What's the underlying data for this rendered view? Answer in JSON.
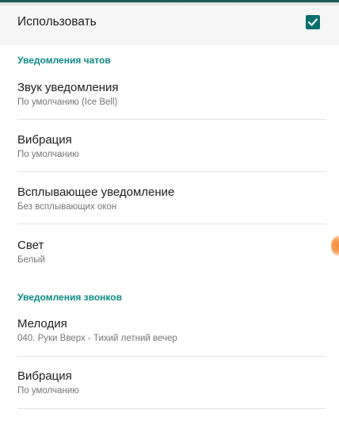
{
  "master": {
    "label": "Использовать",
    "checked": true
  },
  "sections": {
    "chats": {
      "header": "Уведомления чатов",
      "sound": {
        "title": "Звук уведомления",
        "summary": "По умолчанию (Ice Bell)"
      },
      "vibration": {
        "title": "Вибрация",
        "summary": "По умолчанию"
      },
      "popup": {
        "title": "Всплывающее уведомление",
        "summary": "Без всплывающих окон"
      },
      "light": {
        "title": "Свет",
        "summary": "Белый"
      }
    },
    "calls": {
      "header": "Уведомления звонков",
      "ringtone": {
        "title": "Мелодия",
        "summary": "040. Руки Вверх - Тихий летний вечер"
      },
      "vibration": {
        "title": "Вибрация",
        "summary": "По умолчанию"
      }
    }
  },
  "colors": {
    "accent": "#0e8a86",
    "checkbox": "#0a6e6e",
    "light_indicator": "#f28a3a"
  },
  "icons": {
    "checkbox": "check-icon"
  }
}
